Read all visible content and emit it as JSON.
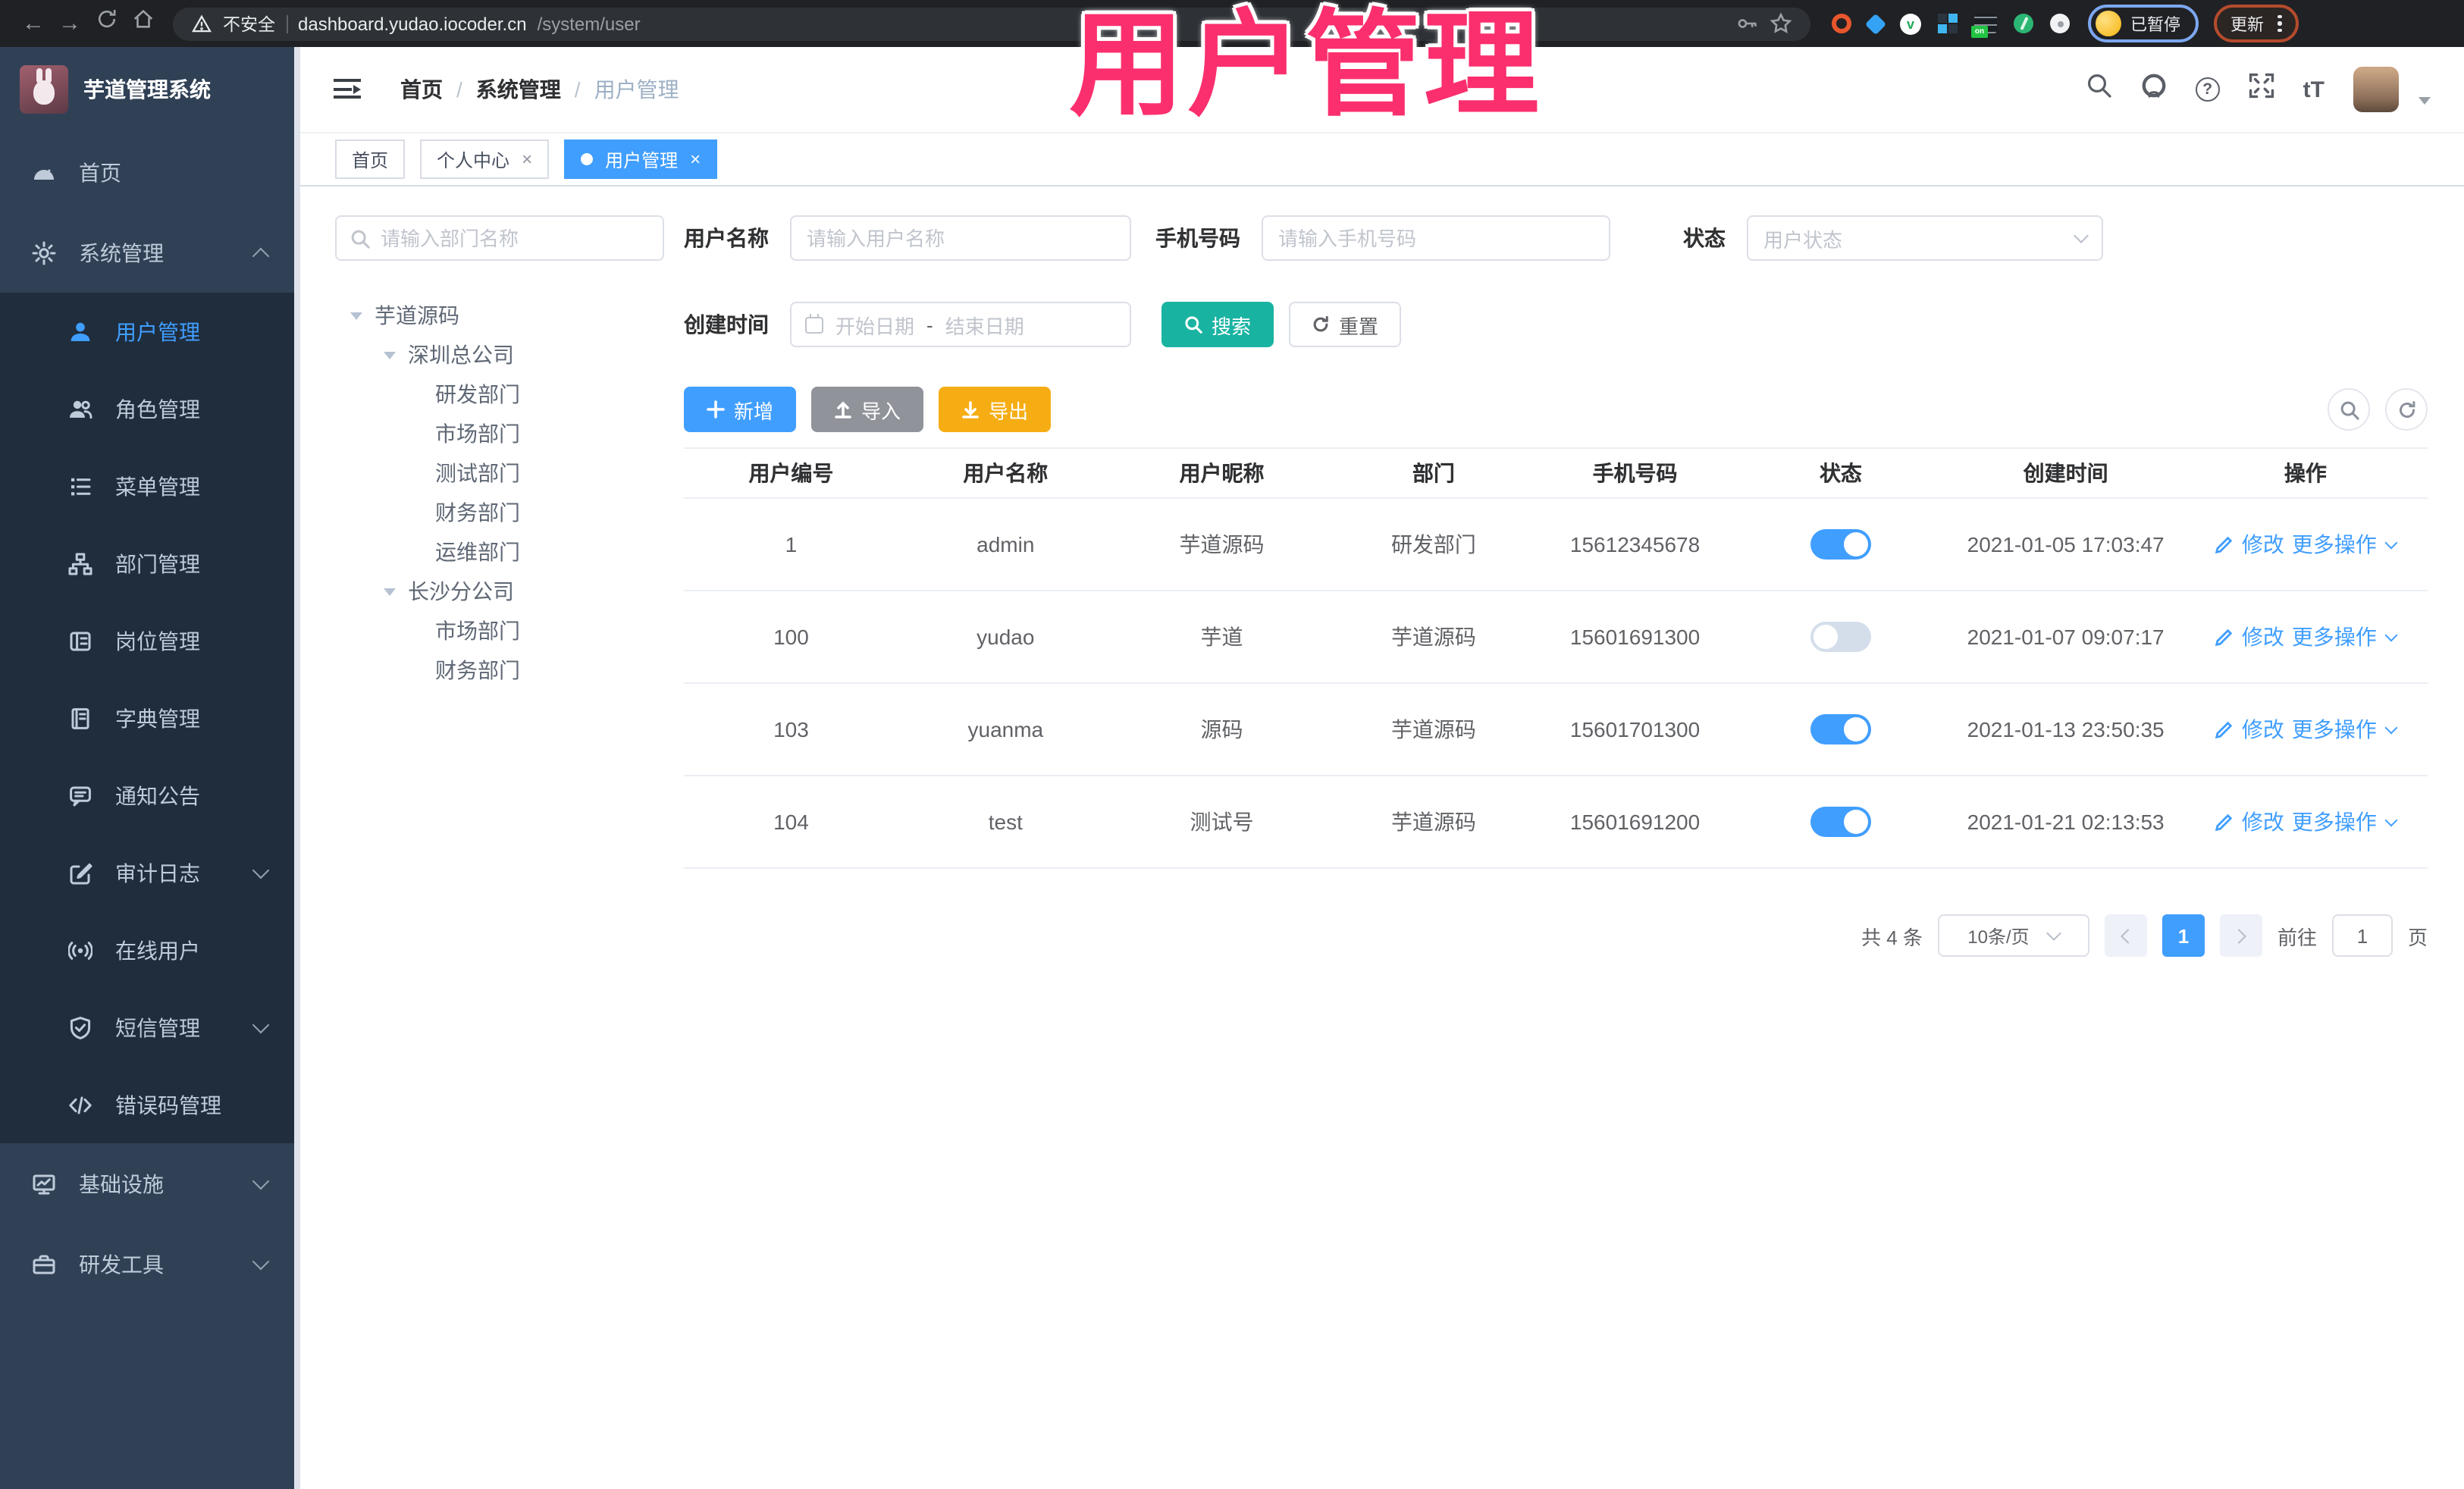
{
  "browser": {
    "security_label": "不安全",
    "url_host": "dashboard.yudao.iocoder.cn",
    "url_path": "/system/user",
    "profile_status": "已暂停",
    "update_label": "更新",
    "onlist_badge": "on",
    "green_ext_letter": "v"
  },
  "overlay_title": "用户管理",
  "sidebar": {
    "logo_title": "芋道管理系统",
    "items": [
      {
        "label": "首页"
      },
      {
        "label": "系统管理"
      },
      {
        "label": "用户管理"
      },
      {
        "label": "角色管理"
      },
      {
        "label": "菜单管理"
      },
      {
        "label": "部门管理"
      },
      {
        "label": "岗位管理"
      },
      {
        "label": "字典管理"
      },
      {
        "label": "通知公告"
      },
      {
        "label": "审计日志"
      },
      {
        "label": "在线用户"
      },
      {
        "label": "短信管理"
      },
      {
        "label": "错误码管理"
      },
      {
        "label": "基础设施"
      },
      {
        "label": "研发工具"
      }
    ]
  },
  "breadcrumb": {
    "items": [
      "首页",
      "系统管理",
      "用户管理"
    ],
    "separator": "/"
  },
  "header_icons": {
    "font_size_label": "tT",
    "help_label": "?"
  },
  "tabs": [
    {
      "label": "首页"
    },
    {
      "label": "个人中心"
    },
    {
      "label": "用户管理"
    }
  ],
  "close_glyph": "×",
  "tree": {
    "search_placeholder": "请输入部门名称",
    "nodes": [
      {
        "label": "芋道源码",
        "depth": 0
      },
      {
        "label": "深圳总公司",
        "depth": 1
      },
      {
        "label": "研发部门",
        "depth": 2
      },
      {
        "label": "市场部门",
        "depth": 2
      },
      {
        "label": "测试部门",
        "depth": 2
      },
      {
        "label": "财务部门",
        "depth": 2
      },
      {
        "label": "运维部门",
        "depth": 2
      },
      {
        "label": "长沙分公司",
        "depth": 1
      },
      {
        "label": "市场部门",
        "depth": 2
      },
      {
        "label": "财务部门",
        "depth": 2
      }
    ]
  },
  "filters": {
    "username_label": "用户名称",
    "username_placeholder": "请输入用户名称",
    "mobile_label": "手机号码",
    "mobile_placeholder": "请输入手机号码",
    "status_label": "状态",
    "status_placeholder": "用户状态",
    "time_label": "创建时间",
    "start_placeholder": "开始日期",
    "range_separator": "-",
    "end_placeholder": "结束日期",
    "search_label": "搜索",
    "reset_label": "重置"
  },
  "toolbar": {
    "add_label": "新增",
    "import_label": "导入",
    "export_label": "导出"
  },
  "table": {
    "columns": [
      "用户编号",
      "用户名称",
      "用户昵称",
      "部门",
      "手机号码",
      "状态",
      "创建时间",
      "操作"
    ],
    "action_edit": "修改",
    "action_more": "更多操作",
    "rows": [
      {
        "id": "1",
        "username": "admin",
        "nickname": "芋道源码",
        "dept": "研发部门",
        "mobile": "15612345678",
        "status_on": true,
        "created": "2021-01-05 17:03:47"
      },
      {
        "id": "100",
        "username": "yudao",
        "nickname": "芋道",
        "dept": "芋道源码",
        "mobile": "15601691300",
        "status_on": false,
        "created": "2021-01-07 09:07:17"
      },
      {
        "id": "103",
        "username": "yuanma",
        "nickname": "源码",
        "dept": "芋道源码",
        "mobile": "15601701300",
        "status_on": true,
        "created": "2021-01-13 23:50:35"
      },
      {
        "id": "104",
        "username": "test",
        "nickname": "测试号",
        "dept": "芋道源码",
        "mobile": "15601691200",
        "status_on": true,
        "created": "2021-01-21 02:13:53"
      }
    ]
  },
  "pagination": {
    "total": "共 4 条",
    "page_size": "10条/页",
    "current_page": "1",
    "goto_label": "前往",
    "goto_value": "1",
    "page_unit": "页"
  },
  "colors": {
    "accent_blue": "#409eff",
    "teal": "#19b3a2",
    "warning_yellow": "#f6ad14",
    "info_gray": "#909399",
    "sidebar_bg": "#304156",
    "submenu_bg": "#1f2d3d",
    "overlay_pink": "#fb2f6d"
  }
}
